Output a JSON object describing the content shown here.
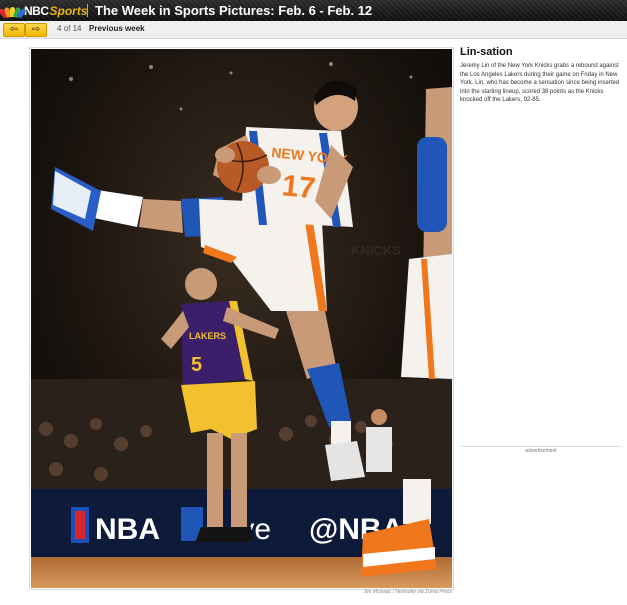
{
  "header": {
    "logo_nbc": "NBC",
    "logo_sports": "Sports",
    "title": "The Week in Sports Pictures: Feb. 6 - Feb. 12"
  },
  "nav": {
    "prev_icon": "arrow-left-icon",
    "next_icon": "arrow-right-icon",
    "prev_glyph": "⇦",
    "next_glyph": "⇨",
    "counter": "4 of 14",
    "previous_week": "Previous week"
  },
  "photo": {
    "credit": "Jim Mcisaac / Newsday via Zuma Press",
    "jersey_top": "NEW YORK",
    "jersey_number": "17",
    "laker_text": "LAKERS",
    "laker_number": "5",
    "banner_left": "NBA",
    "banner_mid": "Live",
    "banner_right": "@NBA",
    "arena_text": "KNICKS"
  },
  "caption": {
    "title": "Lin-sation",
    "body": "Jeremy Lin of the New York Knicks grabs a rebound against the Los Angeles Lakers during their game on Friday in New York. Lin, who has become a sensation since being inserted into the starting lineup, scored 38 points as the Knicks knocked off the Lakers, 92-85."
  },
  "ad": {
    "label": "advertisement"
  },
  "colors": {
    "knicks_blue": "#1f56b8",
    "knicks_orange": "#f0771c",
    "lakers_purple": "#3b1f6a",
    "lakers_gold": "#f2c12e",
    "button_yellow": "#f2b500"
  }
}
